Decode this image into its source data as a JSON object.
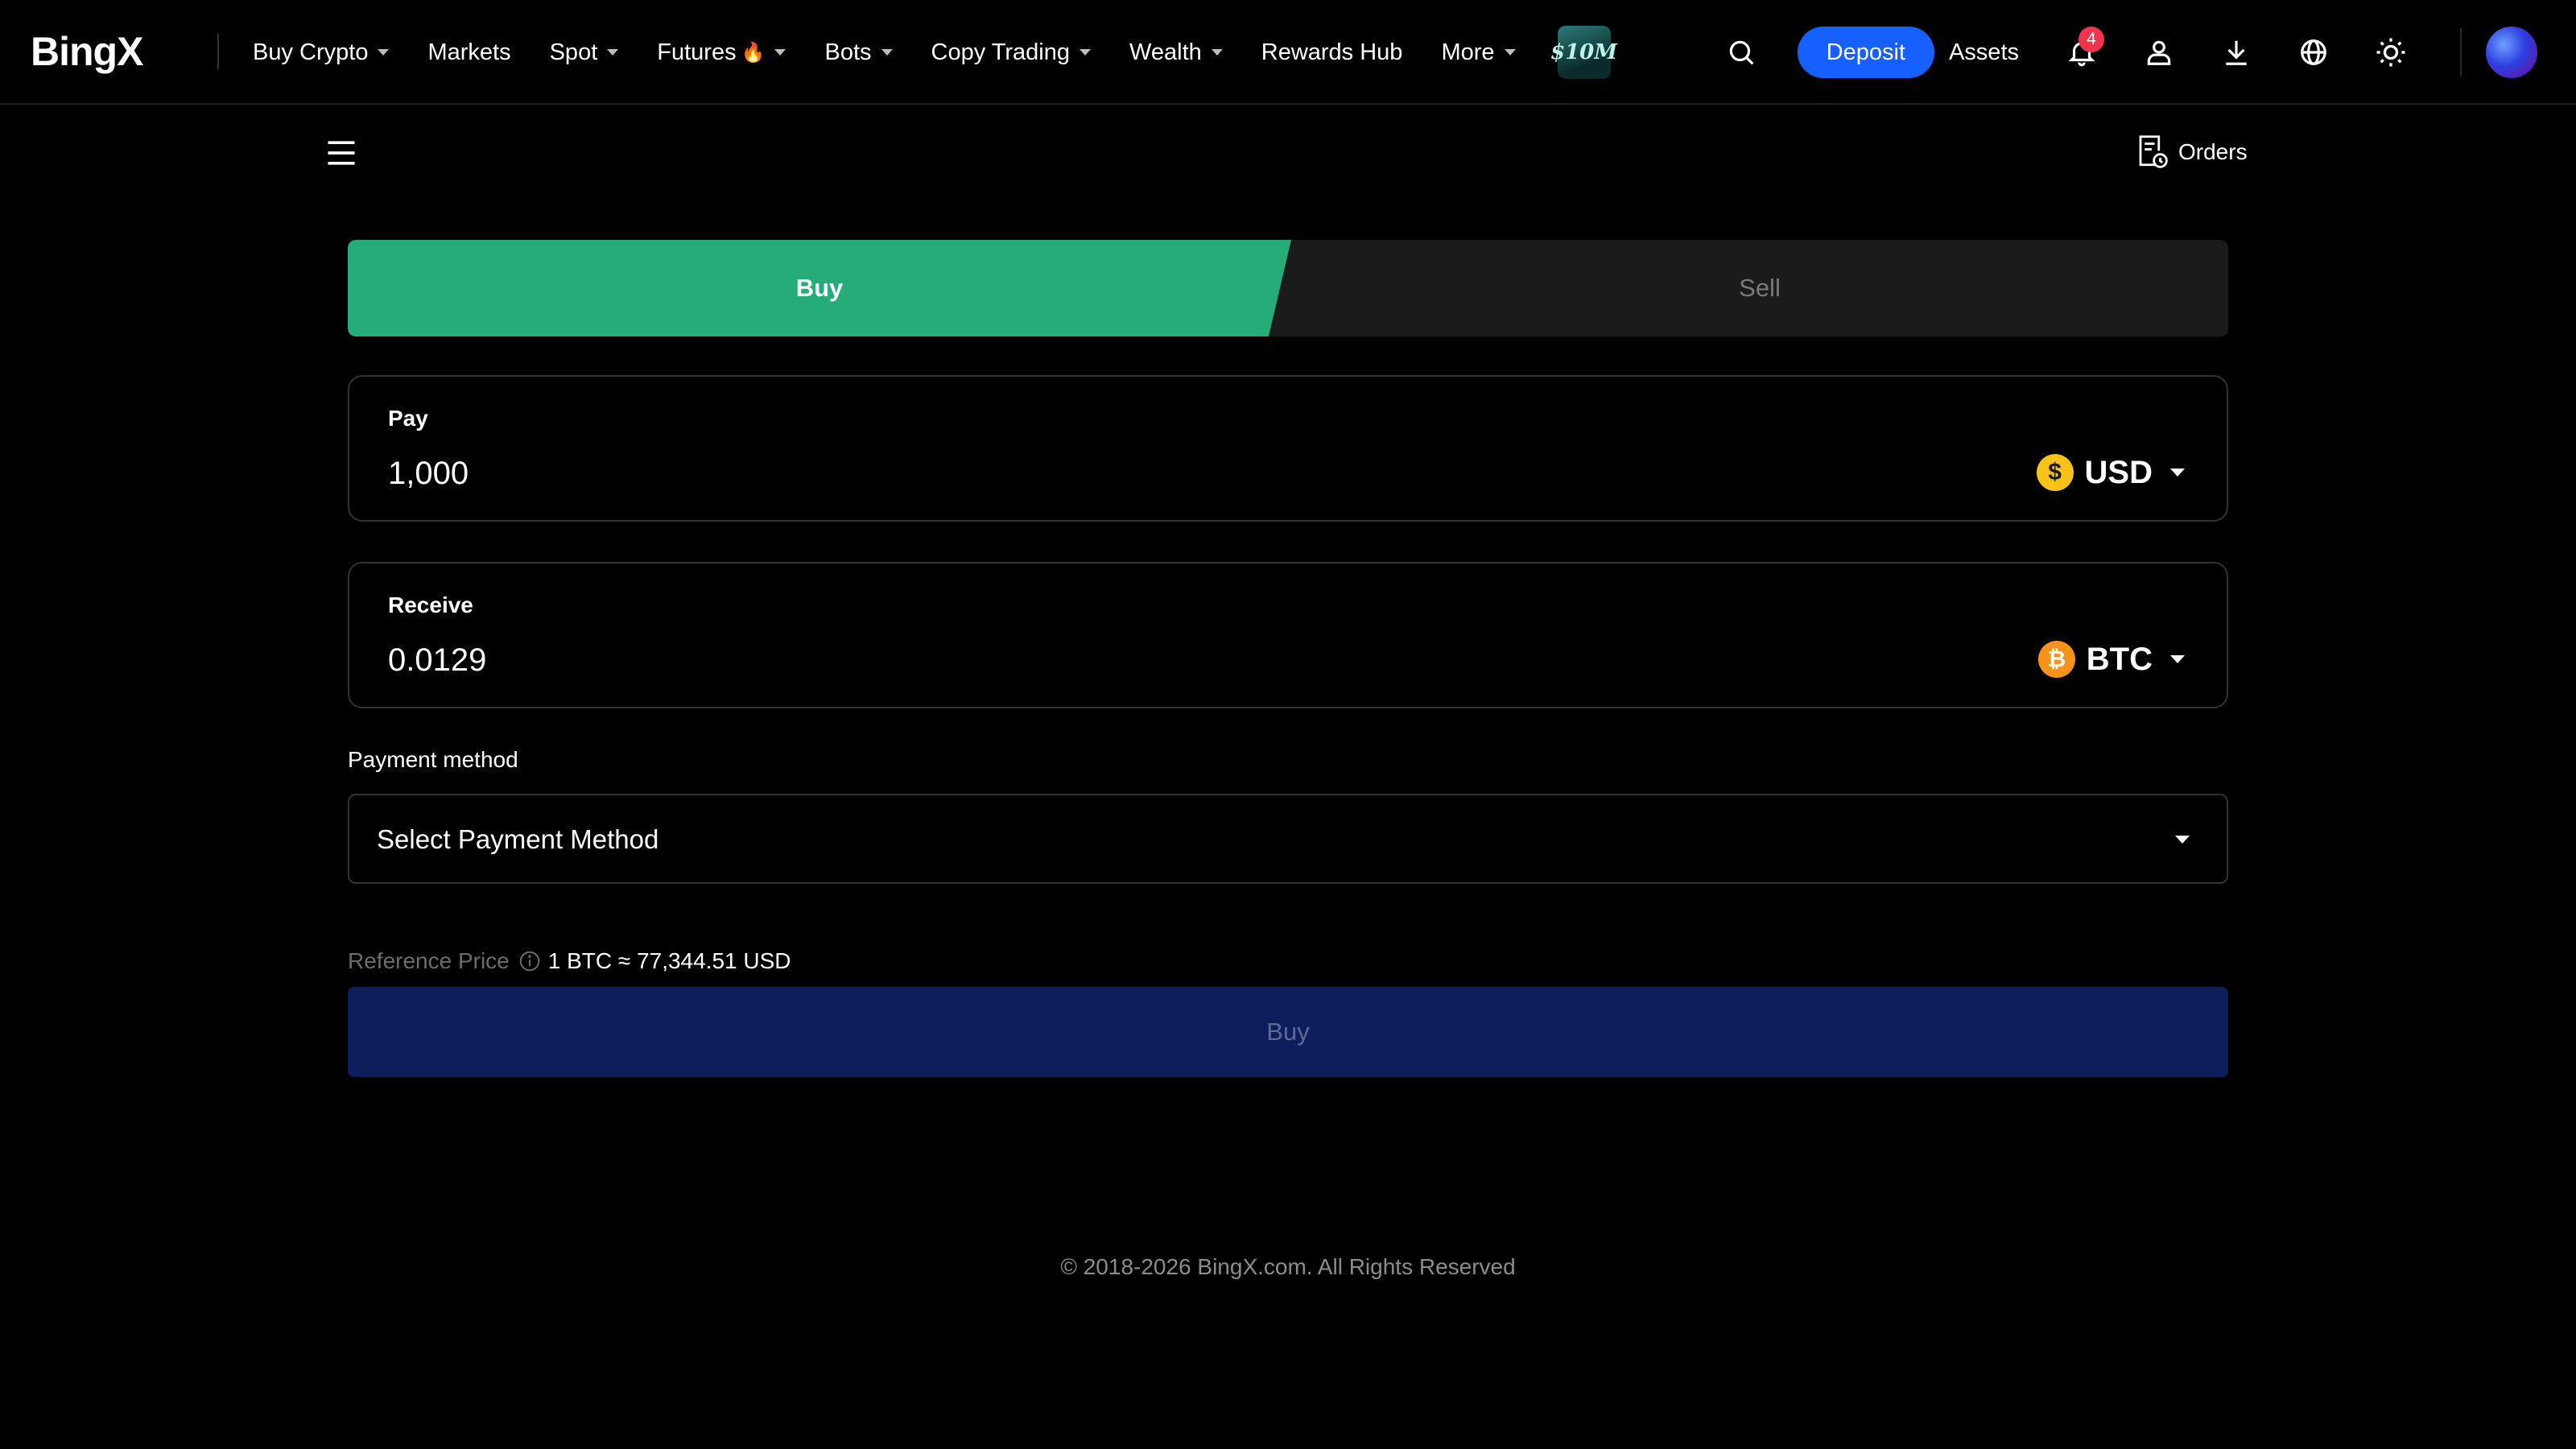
{
  "header": {
    "logo_text": "BingX",
    "nav": [
      {
        "label": "Buy Crypto",
        "has_caret": true
      },
      {
        "label": "Markets",
        "has_caret": false
      },
      {
        "label": "Spot",
        "has_caret": true
      },
      {
        "label": "Futures",
        "has_caret": true,
        "icon": "fire-icon"
      },
      {
        "label": "Bots",
        "has_caret": true
      },
      {
        "label": "Copy Trading",
        "has_caret": true
      },
      {
        "label": "Wealth",
        "has_caret": true
      },
      {
        "label": "Rewards Hub",
        "has_caret": false
      },
      {
        "label": "More",
        "has_caret": true
      }
    ],
    "promo_badge_text": "$10M",
    "deposit_label": "Deposit",
    "assets_label": "Assets",
    "notification_count": "4",
    "icons": [
      "search-icon",
      "bell-icon",
      "user-icon",
      "download-icon",
      "globe-icon",
      "sun-icon"
    ],
    "accent_color": "#1660ff"
  },
  "subheader": {
    "menu_icon": "hamburger-menu-icon",
    "orders_label": "Orders"
  },
  "trade": {
    "tabs": {
      "buy": "Buy",
      "sell": "Sell",
      "active": "buy"
    },
    "pay": {
      "label": "Pay",
      "value": "1,000",
      "currency": "USD",
      "coin_symbol": "$"
    },
    "receive": {
      "label": "Receive",
      "value": "0.0129",
      "currency": "BTC",
      "coin_symbol": "₿"
    },
    "payment_method": {
      "label": "Payment method",
      "placeholder": "Select Payment Method"
    },
    "reference": {
      "label": "Reference Price",
      "value": "1 BTC ≈ 77,344.51 USD"
    },
    "submit_label": "Buy",
    "colors": {
      "buy_tab": "#26ac78",
      "submit_disabled": "#0c1f5c"
    }
  },
  "footer": {
    "copyright": "© 2018-2026 BingX.com. All Rights Reserved"
  }
}
